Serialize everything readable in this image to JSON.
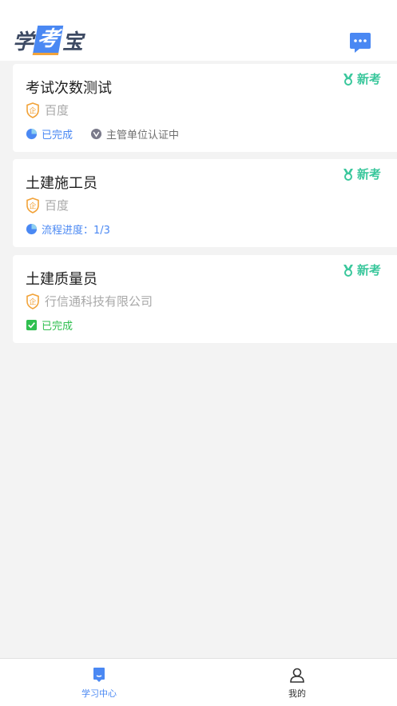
{
  "header": {
    "logo": [
      "学",
      "考",
      "宝"
    ]
  },
  "cards": [
    {
      "title": "考试次数测试",
      "badge": "新考",
      "org": "百度",
      "statuses": [
        {
          "kind": "progress",
          "text": "已完成"
        },
        {
          "kind": "verify",
          "text": "主管单位认证中"
        }
      ]
    },
    {
      "title": "土建施工员",
      "badge": "新考",
      "org": "百度",
      "statuses": [
        {
          "kind": "progress",
          "text": "流程进度：1/3"
        }
      ]
    },
    {
      "title": "土建质量员",
      "badge": "新考",
      "org": "行信通科技有限公司",
      "statuses": [
        {
          "kind": "done",
          "text": "已完成"
        }
      ]
    }
  ],
  "tabbar": {
    "study_center": "学习中心",
    "mine": "我的"
  },
  "colors": {
    "accent": "#4a88f3",
    "badge_green": "#3ac79c",
    "org_orange": "#f2a33a",
    "done_green": "#2fbf4f"
  }
}
